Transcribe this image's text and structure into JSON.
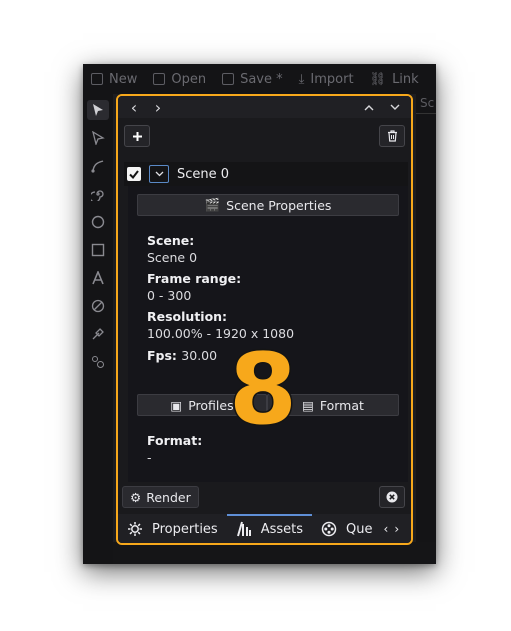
{
  "app_toolbar": {
    "items": [
      {
        "label": "New",
        "icon": "new-file-icon"
      },
      {
        "label": "Open",
        "icon": "folder-icon"
      },
      {
        "label": "Save *",
        "icon": "save-icon"
      },
      {
        "label": "Import",
        "icon": "import-icon"
      },
      {
        "label": "Link",
        "icon": "link-icon"
      }
    ]
  },
  "right_tab": {
    "label": "Sc"
  },
  "panel": {
    "nav": {
      "back": "‹",
      "forward": "›",
      "up": "^",
      "down": "v"
    },
    "scene": {
      "name": "Scene 0",
      "checked": true
    },
    "scene_properties_button": "Scene Properties",
    "fields": {
      "scene_label": "Scene:",
      "scene_value": "Scene 0",
      "frame_range_label": "Frame range:",
      "frame_range_value": "0 - 300",
      "resolution_label": "Resolution:",
      "resolution_value": "100.00% - 1920 x 1080",
      "fps_label": "Fps:",
      "fps_value": "30.00",
      "format_label": "Format:",
      "format_value": "-"
    },
    "profiles_button": "Profiles",
    "format_button": "Format",
    "render_button": "Render",
    "tabs": [
      {
        "label": "Properties",
        "icon": "sun-gear-icon",
        "active": false
      },
      {
        "label": "Assets",
        "icon": "assets-icon",
        "active": true
      },
      {
        "label": "Que",
        "icon": "film-reel-icon",
        "active": false
      }
    ]
  },
  "step_number": "8",
  "colors": {
    "highlight": "#f7a81b",
    "active_tab": "#5f8fd6",
    "checkbox_border": "#5a89c6"
  }
}
